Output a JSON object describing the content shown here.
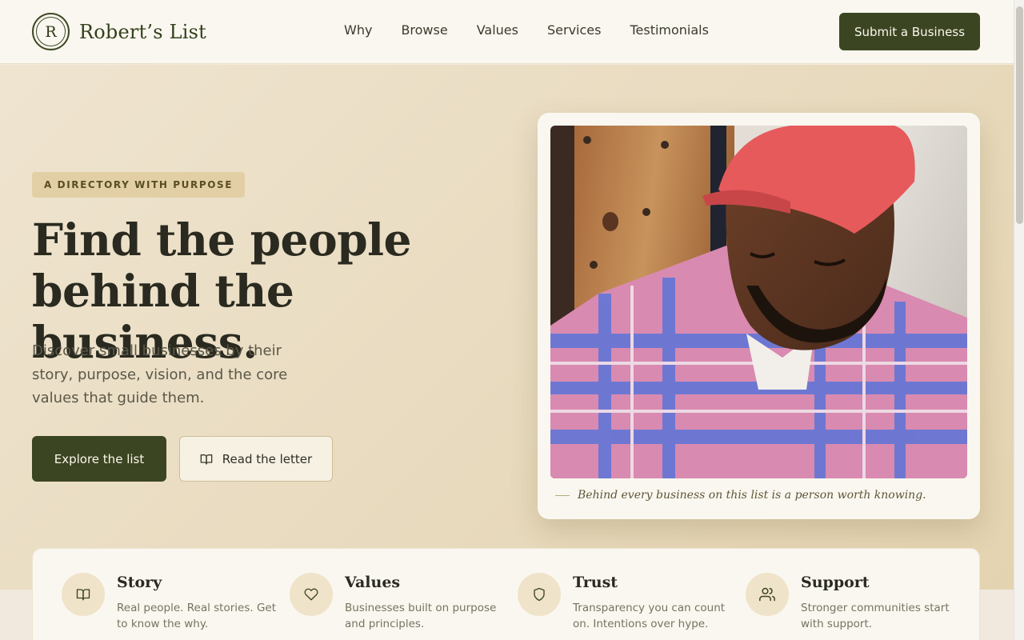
{
  "brand": {
    "mark": "R",
    "name": "Robert’s List"
  },
  "nav": [
    {
      "label": "Why"
    },
    {
      "label": "Browse"
    },
    {
      "label": "Values"
    },
    {
      "label": "Services"
    },
    {
      "label": "Testimonials"
    }
  ],
  "header": {
    "cta_label": "Submit a Business"
  },
  "hero": {
    "eyebrow": "A DIRECTORY WITH PURPOSE",
    "title_line1": "Find the people",
    "title_line2": "behind the business.",
    "subtitle": "Discover small businesses by their story, purpose, vision, and the core values that guide them.",
    "primary_cta": "Explore the list",
    "secondary_cta": "Read the letter",
    "secondary_cta_icon": "open-book-icon",
    "caption": "Behind every business on this list is a person worth knowing."
  },
  "features": [
    {
      "title": "Story",
      "text": "Real people. Real stories. Get to know the why.",
      "icon": "open-book-icon"
    },
    {
      "title": "Values",
      "text": "Businesses built on purpose and principles.",
      "icon": "heart-icon"
    },
    {
      "title": "Trust",
      "text": "Transparency you can count on. Intentions over hype.",
      "icon": "shield-icon"
    },
    {
      "title": "Support",
      "text": "Stronger communities start with support.",
      "icon": "users-icon"
    }
  ],
  "colors": {
    "accent": "#3c4521",
    "background": "#f3ebdd",
    "eyebrow_bg": "#e2cfa5",
    "card": "#faf7f0"
  }
}
